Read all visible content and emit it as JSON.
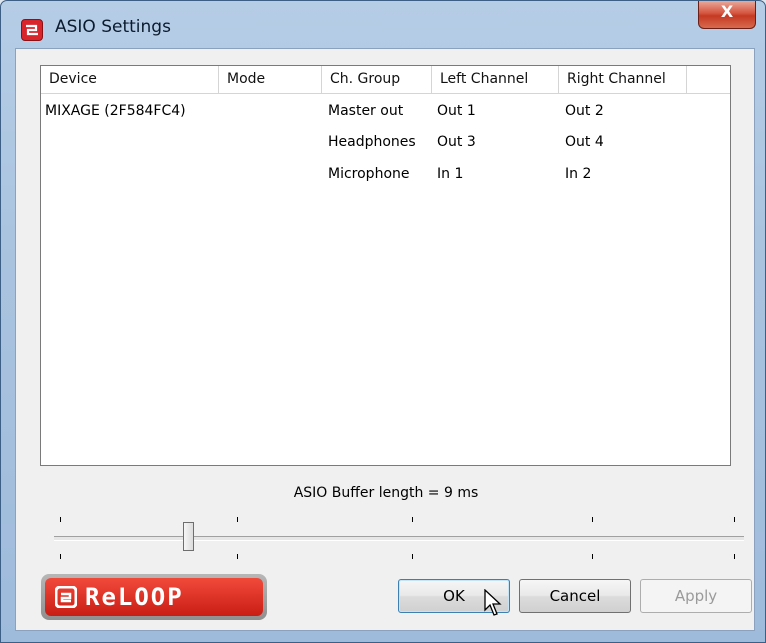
{
  "window": {
    "title": "ASIO Settings",
    "close_glyph": "X"
  },
  "table": {
    "headers": [
      "Device",
      "Mode",
      "Ch. Group",
      "Left Channel",
      "Right Channel"
    ],
    "rows": [
      {
        "device": "MIXAGE (2F584FC4)",
        "mode": "",
        "group": "Master out",
        "left": "Out 1",
        "right": "Out 2"
      },
      {
        "device": "",
        "mode": "",
        "group": "Headphones",
        "left": "Out 3",
        "right": "Out 4"
      },
      {
        "device": "",
        "mode": "",
        "group": "Microphone",
        "left": "In 1",
        "right": "In 2"
      }
    ]
  },
  "buffer": {
    "label": "ASIO Buffer length = 9 ms",
    "slider_fraction": 0.19
  },
  "logo": {
    "text": "ReLOOP"
  },
  "buttons": {
    "ok": "OK",
    "cancel": "Cancel",
    "apply": "Apply"
  },
  "colors": {
    "accent": "#d8242b",
    "title_text": "#0b1b2e"
  }
}
